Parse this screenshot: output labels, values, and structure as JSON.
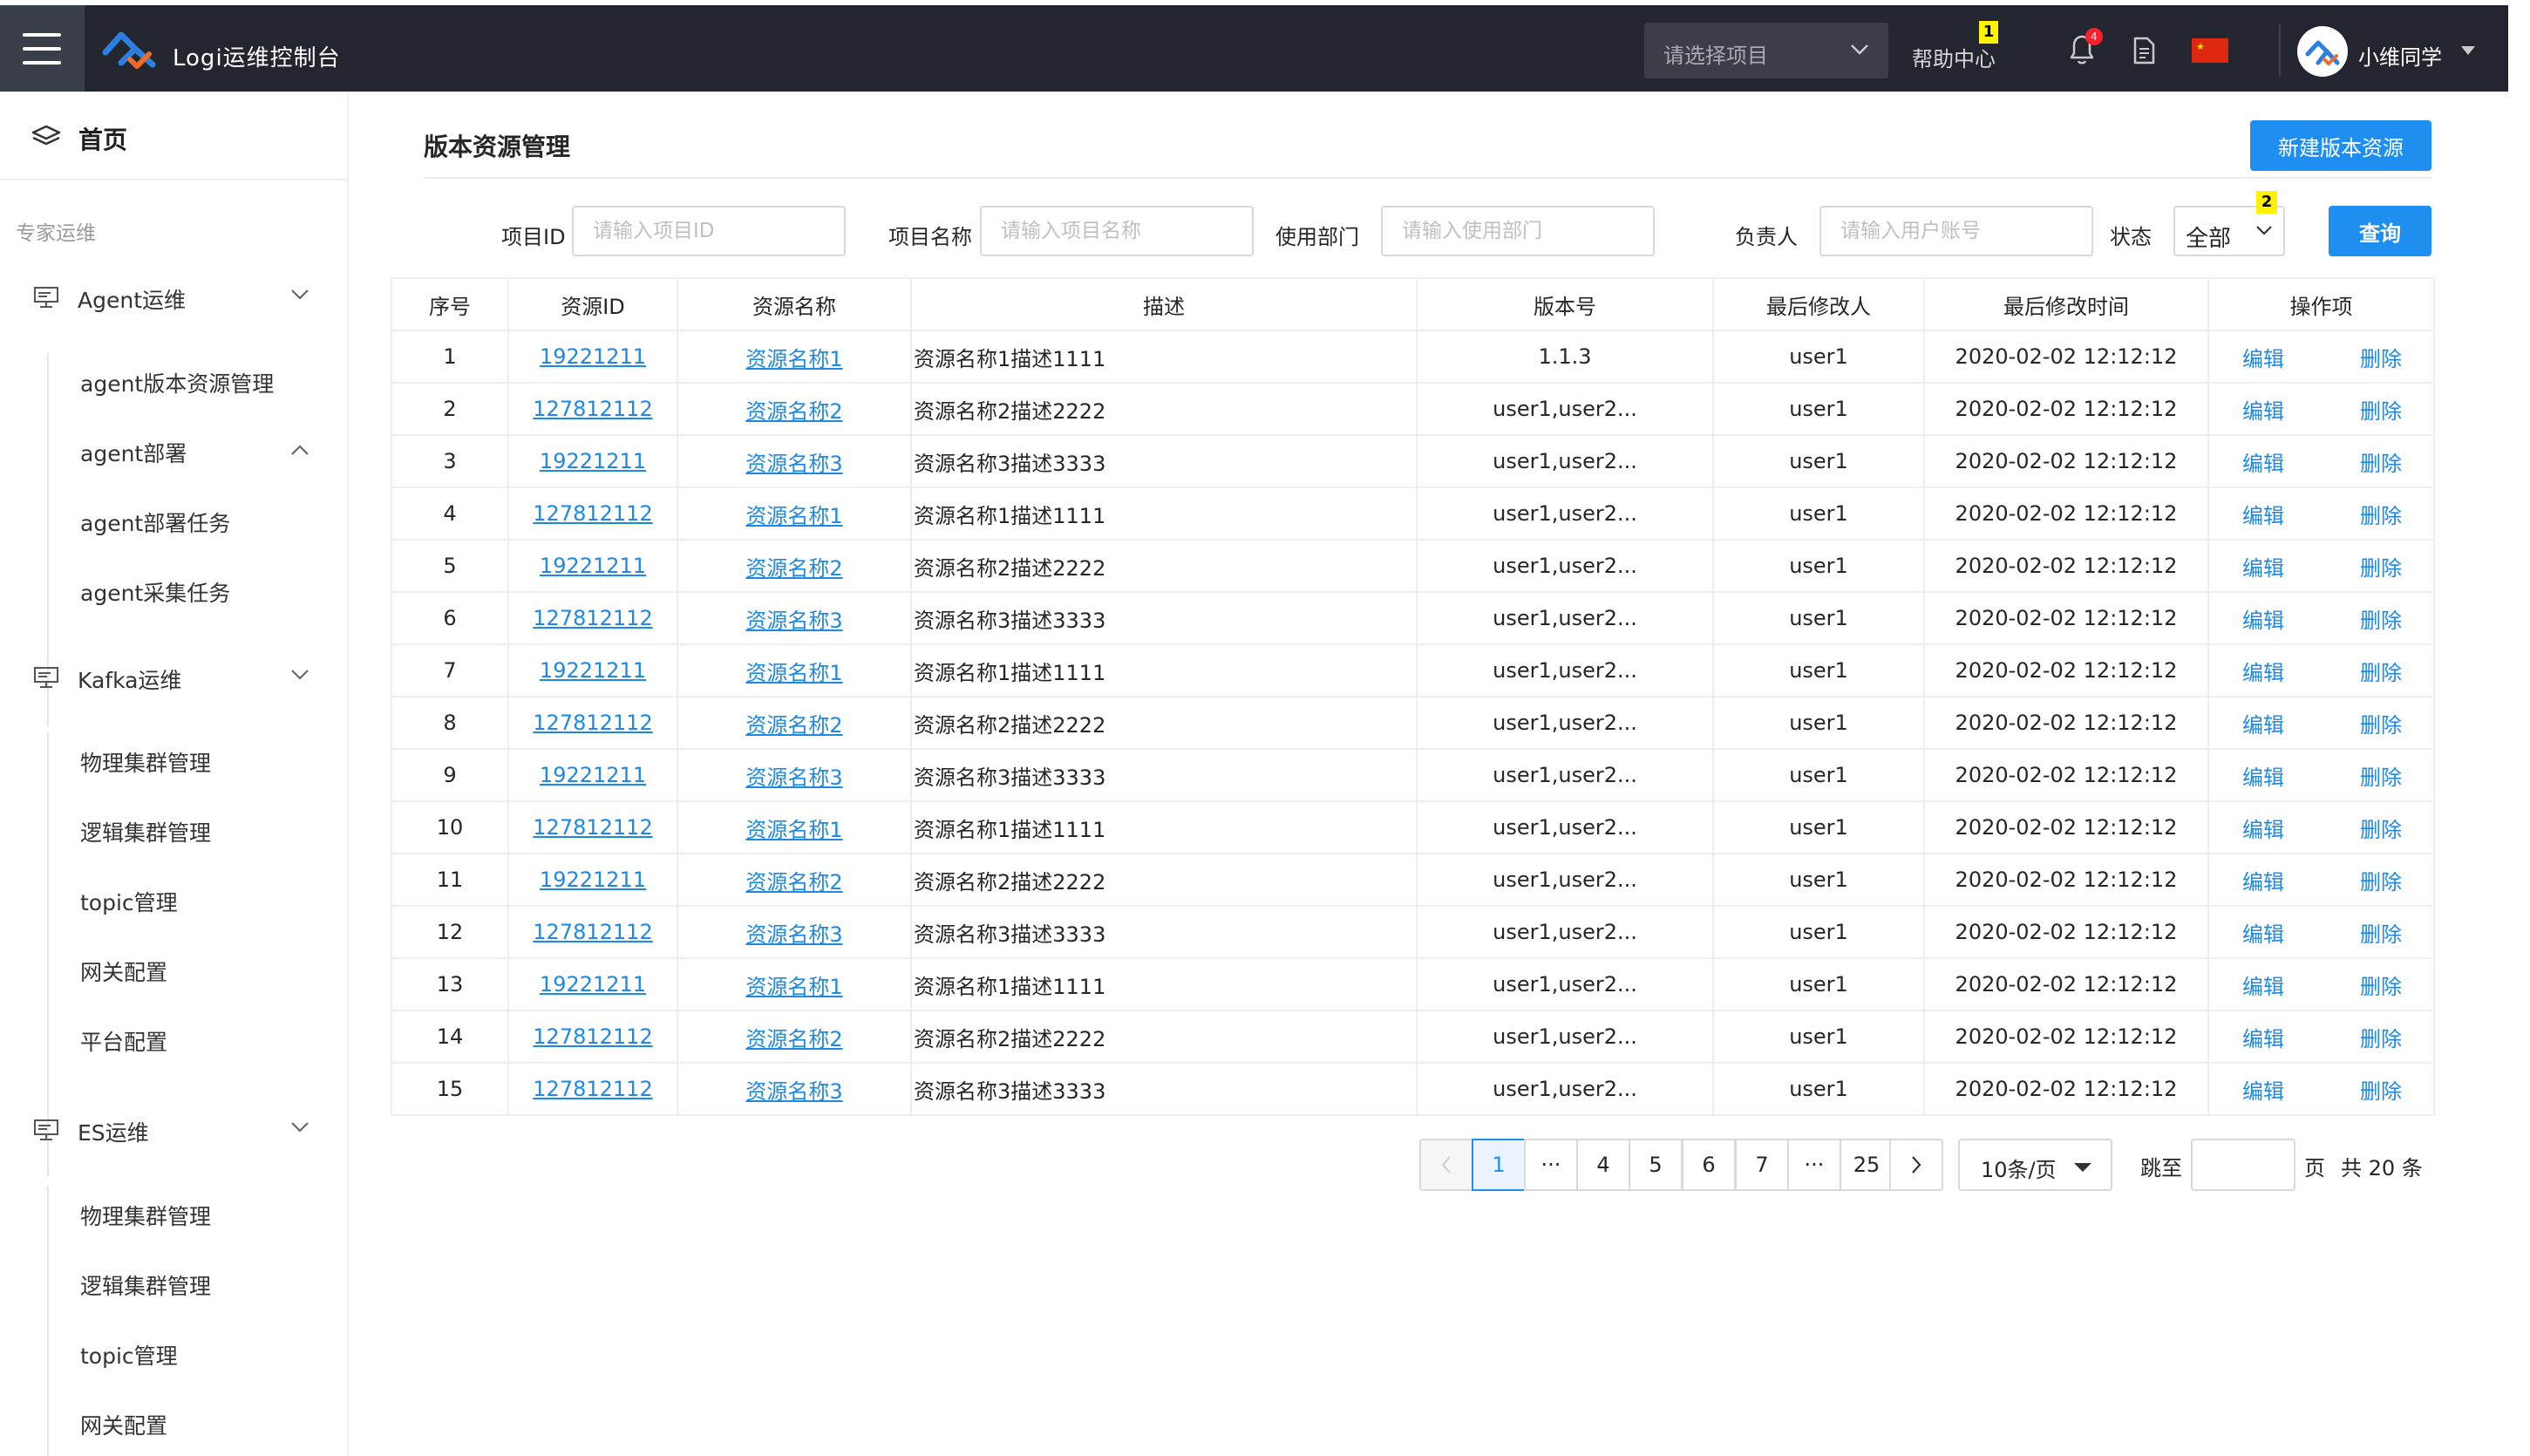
{
  "header": {
    "brand": "Logi运维控制台",
    "project_select_placeholder": "请选择项目",
    "help": "帮助中心",
    "help_badge": "1",
    "notification_count": "4",
    "username": "小维同学"
  },
  "sidebar": {
    "home": "首页",
    "section": "专家运维",
    "groups": [
      {
        "label": "Agent运维",
        "items": [
          "agent版本资源管理",
          "agent部署",
          "agent部署任务",
          "agent采集任务"
        ]
      },
      {
        "label": "Kafka运维",
        "items": [
          "物理集群管理",
          "逻辑集群管理",
          "topic管理",
          "网关配置",
          "平台配置"
        ]
      },
      {
        "label": "ES运维",
        "items": [
          "物理集群管理",
          "逻辑集群管理",
          "topic管理",
          "网关配置"
        ]
      }
    ]
  },
  "main": {
    "title": "版本资源管理",
    "new_button": "新建版本资源",
    "filters": {
      "project_id_label": "项目ID",
      "project_id_placeholder": "请输入项目ID",
      "project_name_label": "项目名称",
      "project_name_placeholder": "请输入项目名称",
      "dept_label": "使用部门",
      "dept_placeholder": "请输入使用部门",
      "owner_label": "负责人",
      "owner_placeholder": "请输入用户账号",
      "status_label": "状态",
      "status_value": "全部",
      "status_badge": "2",
      "query_button": "查询"
    },
    "table": {
      "columns": [
        "序号",
        "资源ID",
        "资源名称",
        "描述",
        "版本号",
        "最后修改人",
        "最后修改时间",
        "操作项"
      ],
      "edit_label": "编辑",
      "delete_label": "删除",
      "rows": [
        {
          "no": "1",
          "rid": "19221211",
          "name": "资源名称1",
          "desc": "资源名称1描述1111",
          "ver": "1.1.3",
          "user": "user1",
          "time": "2020-02-02 12:12:12"
        },
        {
          "no": "2",
          "rid": "127812112",
          "name": "资源名称2",
          "desc": "资源名称2描述2222",
          "ver": "user1,user2...",
          "user": "user1",
          "time": "2020-02-02 12:12:12"
        },
        {
          "no": "3",
          "rid": "19221211",
          "name": "资源名称3",
          "desc": "资源名称3描述3333",
          "ver": "user1,user2...",
          "user": "user1",
          "time": "2020-02-02 12:12:12"
        },
        {
          "no": "4",
          "rid": "127812112",
          "name": "资源名称1",
          "desc": "资源名称1描述1111",
          "ver": "user1,user2...",
          "user": "user1",
          "time": "2020-02-02 12:12:12"
        },
        {
          "no": "5",
          "rid": "19221211",
          "name": "资源名称2",
          "desc": "资源名称2描述2222",
          "ver": "user1,user2...",
          "user": "user1",
          "time": "2020-02-02 12:12:12"
        },
        {
          "no": "6",
          "rid": "127812112",
          "name": "资源名称3",
          "desc": "资源名称3描述3333",
          "ver": "user1,user2...",
          "user": "user1",
          "time": "2020-02-02 12:12:12"
        },
        {
          "no": "7",
          "rid": "19221211",
          "name": "资源名称1",
          "desc": "资源名称1描述1111",
          "ver": "user1,user2...",
          "user": "user1",
          "time": "2020-02-02 12:12:12"
        },
        {
          "no": "8",
          "rid": "127812112",
          "name": "资源名称2",
          "desc": "资源名称2描述2222",
          "ver": "user1,user2...",
          "user": "user1",
          "time": "2020-02-02 12:12:12"
        },
        {
          "no": "9",
          "rid": "19221211",
          "name": "资源名称3",
          "desc": "资源名称3描述3333",
          "ver": "user1,user2...",
          "user": "user1",
          "time": "2020-02-02 12:12:12"
        },
        {
          "no": "10",
          "rid": "127812112",
          "name": "资源名称1",
          "desc": "资源名称1描述1111",
          "ver": "user1,user2...",
          "user": "user1",
          "time": "2020-02-02 12:12:12"
        },
        {
          "no": "11",
          "rid": "19221211",
          "name": "资源名称2",
          "desc": "资源名称2描述2222",
          "ver": "user1,user2...",
          "user": "user1",
          "time": "2020-02-02 12:12:12"
        },
        {
          "no": "12",
          "rid": "127812112",
          "name": "资源名称3",
          "desc": "资源名称3描述3333",
          "ver": "user1,user2...",
          "user": "user1",
          "time": "2020-02-02 12:12:12"
        },
        {
          "no": "13",
          "rid": "19221211",
          "name": "资源名称1",
          "desc": "资源名称1描述1111",
          "ver": "user1,user2...",
          "user": "user1",
          "time": "2020-02-02 12:12:12"
        },
        {
          "no": "14",
          "rid": "127812112",
          "name": "资源名称2",
          "desc": "资源名称2描述2222",
          "ver": "user1,user2...",
          "user": "user1",
          "time": "2020-02-02 12:12:12"
        },
        {
          "no": "15",
          "rid": "127812112",
          "name": "资源名称3",
          "desc": "资源名称3描述3333",
          "ver": "user1,user2...",
          "user": "user1",
          "time": "2020-02-02 12:12:12"
        }
      ]
    },
    "pagination": {
      "pages": [
        "1",
        "···",
        "4",
        "5",
        "6",
        "7",
        "···",
        "25"
      ],
      "current": "1",
      "page_size": "10条/页",
      "jump_label": "跳至",
      "page_suffix": "页",
      "total": "共 20 条"
    }
  },
  "colors": {
    "topbar": "#23262e",
    "primary": "#1f8ef1",
    "link": "#1e88e5",
    "badge": "#fff200"
  }
}
